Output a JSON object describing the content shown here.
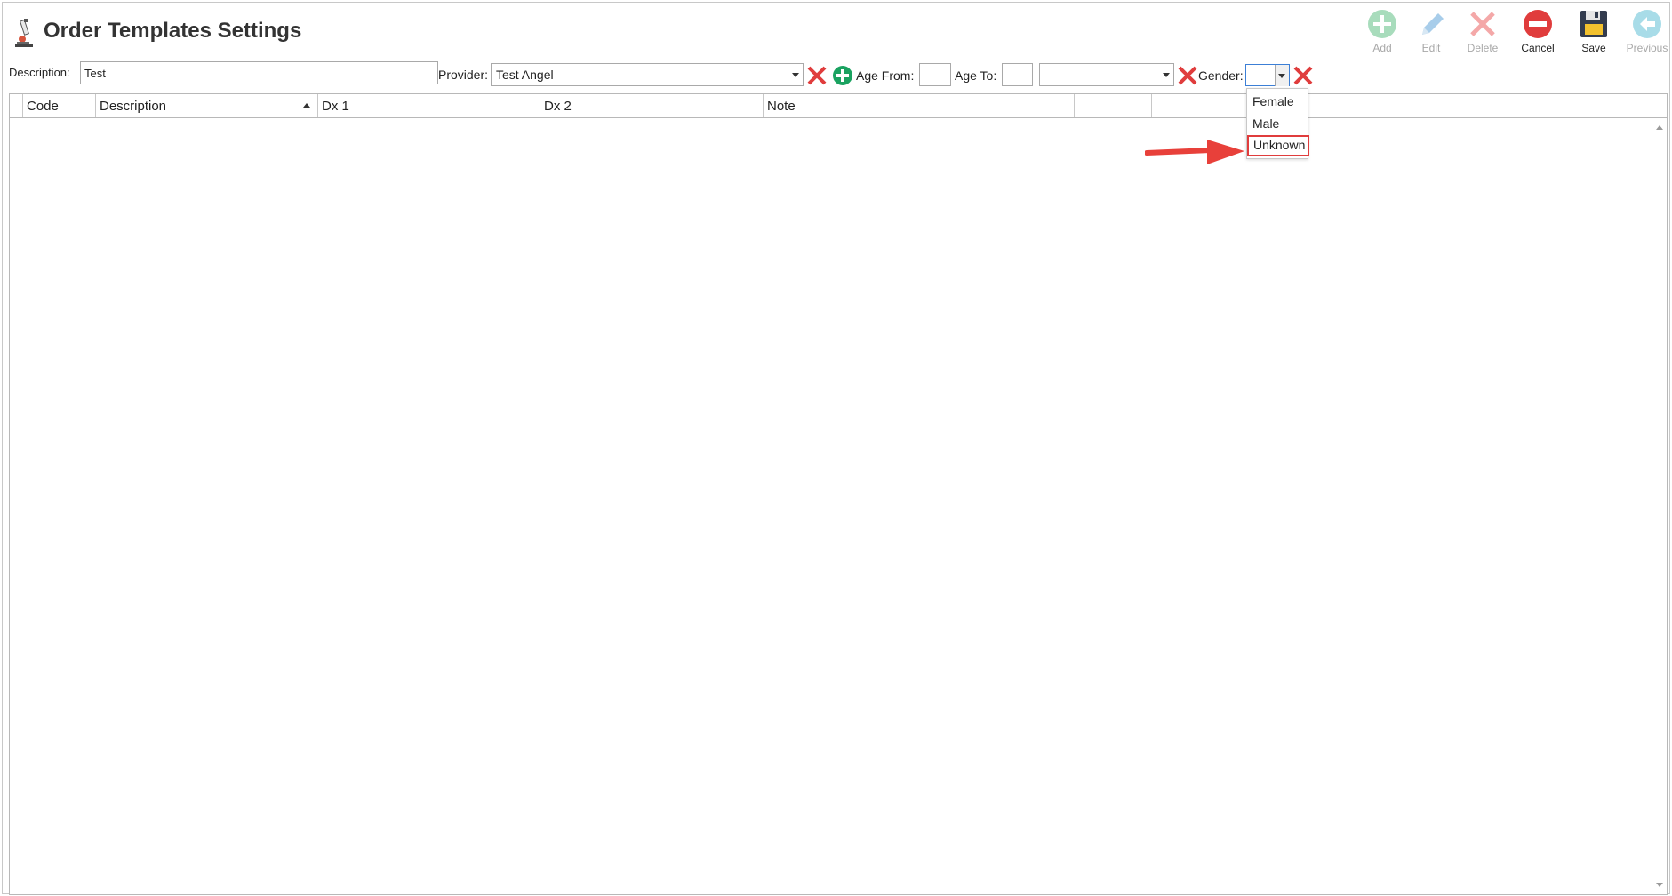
{
  "window": {
    "title": "Order Templates Settings"
  },
  "toolbar": {
    "add_label": "Add",
    "edit_label": "Edit",
    "delete_label": "Delete",
    "cancel_label": "Cancel",
    "save_label": "Save",
    "previous_label": "Previous"
  },
  "filters": {
    "description_label": "Description:",
    "description_value": "Test",
    "provider_label": "Provider:",
    "provider_value": "Test Angel",
    "age_from_label": "Age From:",
    "age_from_value": "",
    "age_to_label": "Age To:",
    "age_to_value": "",
    "age_unit_value": "",
    "gender_label": "Gender:",
    "gender_value": ""
  },
  "grid": {
    "columns": [
      {
        "label": "Code"
      },
      {
        "label": "Description"
      },
      {
        "label": "Dx 1"
      },
      {
        "label": "Dx 2"
      },
      {
        "label": "Note"
      },
      {
        "label": ""
      },
      {
        "label": ""
      }
    ],
    "rows": []
  },
  "gender_dropdown": {
    "options": [
      "Female",
      "Male",
      "Unknown"
    ],
    "highlighted": "Unknown"
  },
  "colors": {
    "accent_blue": "#3c7fd6",
    "delete_red": "#e03c3c",
    "add_green": "#1aa260",
    "highlight_red": "#e03c3c"
  }
}
